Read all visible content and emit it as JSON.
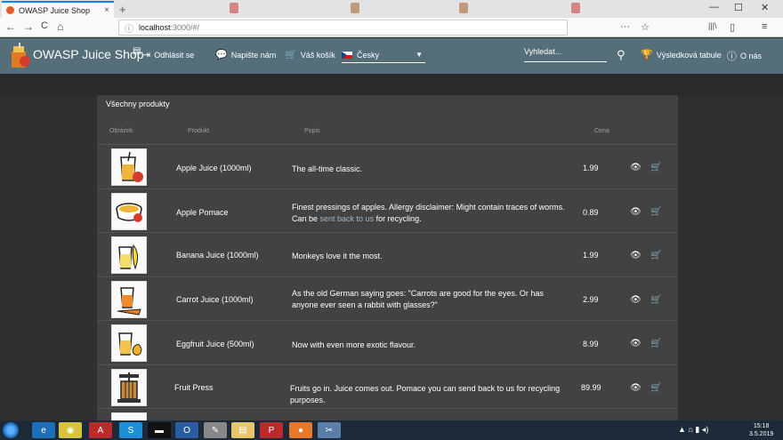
{
  "browser": {
    "tab_title": "OWASP Juice Shop",
    "tab_close": "×",
    "new_tab": "+",
    "url_host": "localhost",
    "url_path": ":3000/#/",
    "url_lock": "ⓘ",
    "back": "←",
    "forward": "→",
    "reload": "C",
    "home": "⌂",
    "more": "···",
    "bookmark": "☆",
    "library": "|||\\",
    "sidebar": "▯",
    "menu": "≡",
    "minimize": "—",
    "maximize": "☐",
    "close": "✕"
  },
  "app": {
    "title": "OWASP Juice Shop",
    "colors": {
      "toolbar": "#546e7a",
      "background": "#303030",
      "card": "#424242"
    },
    "nav": {
      "logout": "Odhlásit se",
      "contact": "Napište nám",
      "basket": "Váš košík",
      "language": "Česky",
      "search_placeholder": "Vyhledat...",
      "scoreboard": "Výsledková tabule",
      "about": "O nás"
    }
  },
  "products": {
    "title": "Všechny produkty",
    "columns": {
      "image": "Obrázek",
      "product": "Produkt",
      "description": "Popis",
      "price": "Cena"
    },
    "items": [
      {
        "name": "Apple Juice (1000ml)",
        "description": "The all-time classic.",
        "price": "1.99",
        "image_icon": "apple-juice-icon"
      },
      {
        "name": "Apple Pomace",
        "description_a": "Finest pressings of apples. Allergy disclaimer: Might contain traces of worms. Can be ",
        "description_link": "sent back to us",
        "description_b": " for recycling.",
        "price": "0.89",
        "image_icon": "apple-pomace-icon"
      },
      {
        "name": "Banana Juice (1000ml)",
        "description": "Monkeys love it the most.",
        "price": "1.99",
        "image_icon": "banana-juice-icon"
      },
      {
        "name": "Carrot Juice (1000ml)",
        "description": "As the old German saying goes: \"Carrots are good for the eyes. Or has anyone ever seen a rabbit with glasses?\"",
        "price": "2.99",
        "image_icon": "carrot-juice-icon"
      },
      {
        "name": "Eggfruit Juice (500ml)",
        "description": "Now with even more exotic flavour.",
        "price": "8.99",
        "image_icon": "eggfruit-juice-icon"
      },
      {
        "name": "Fruit Press",
        "description": "Fruits go in. Juice comes out. Pomace you can send back to us for recycling purposes.",
        "price": "89.99",
        "image_icon": "fruit-press-icon"
      }
    ]
  },
  "taskbar": {
    "time": "15:18",
    "date": "3.5.2019",
    "apps": [
      "ie-icon",
      "chrome-icon",
      "acrobat-icon",
      "skype-icon",
      "terminal-icon",
      "outlook-icon",
      "paint-icon",
      "files-icon",
      "pdf-icon",
      "firefox-icon",
      "snipping-icon"
    ]
  }
}
